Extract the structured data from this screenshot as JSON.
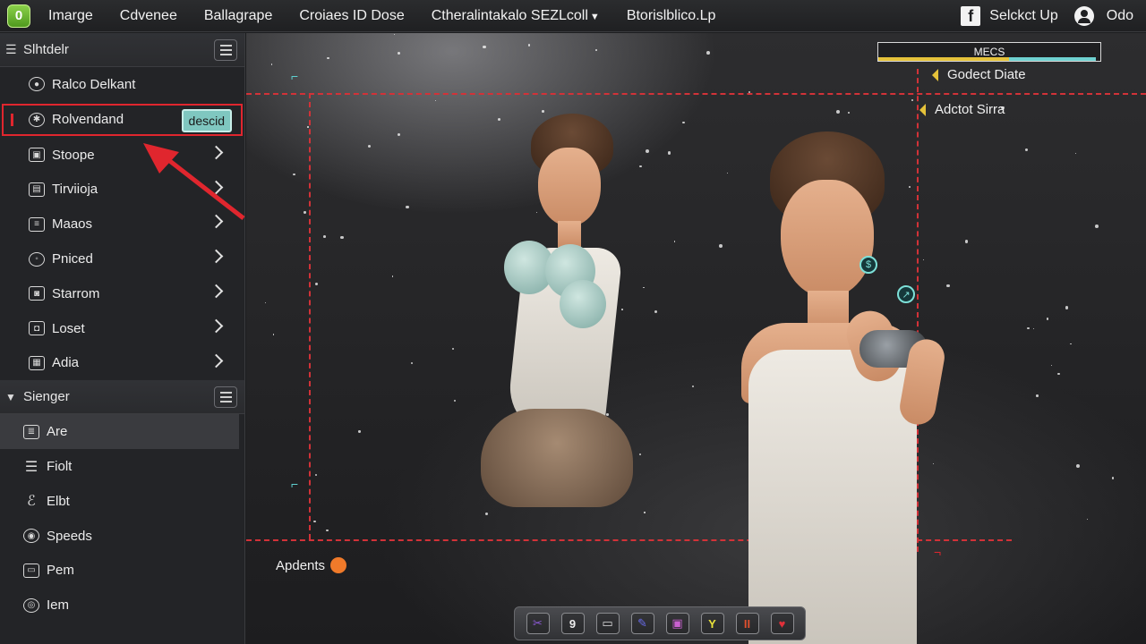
{
  "menu": {
    "items": [
      "Imarge",
      "Cdvenee",
      "Ballagrape",
      "Croiaes ID Dose",
      "Ctheralintakalo SEZLcoll",
      "Btorislblico.Lp"
    ],
    "dropdown_index": 4,
    "right": {
      "signin": "Selckct Up",
      "user": "Odo"
    }
  },
  "sidebar": {
    "section1": {
      "title": "Slhtdelr",
      "items": [
        {
          "label": "Ralco Delkant",
          "icon": "person-icon",
          "has_chevron": false
        },
        {
          "label": "Rolvendand",
          "icon": "gear-icon",
          "badge": "descid",
          "selected": true
        },
        {
          "label": "Stoope",
          "icon": "image-icon",
          "has_chevron": true
        },
        {
          "label": "Tirviioja",
          "icon": "image-icon",
          "has_chevron": true
        },
        {
          "label": "Maaos",
          "icon": "document-icon",
          "has_chevron": true
        },
        {
          "label": "Pniced",
          "icon": "pin-icon",
          "has_chevron": true
        },
        {
          "label": "Starrom",
          "icon": "camera-icon",
          "has_chevron": true
        },
        {
          "label": "Loset",
          "icon": "folder-icon",
          "has_chevron": true
        },
        {
          "label": "Adia",
          "icon": "stack-icon",
          "has_chevron": true
        }
      ]
    },
    "section2": {
      "title": "Sienger",
      "items": [
        {
          "label": "Are",
          "icon": "list-icon",
          "active": true
        },
        {
          "label": "Fiolt",
          "icon": "lines-icon"
        },
        {
          "label": "Elbt",
          "icon": "edit-icon"
        },
        {
          "label": "Speeds",
          "icon": "speed-icon"
        },
        {
          "label": "Pem",
          "icon": "pen-icon"
        },
        {
          "label": "Iem",
          "icon": "target-icon"
        }
      ]
    }
  },
  "canvas": {
    "stats_label": "MECS",
    "stats_fill": 0.98,
    "notes": [
      "Godect Diate",
      "Adctot Sirra"
    ],
    "appends_label": "Apdents",
    "marker_glyphs": [
      "$",
      "↗"
    ]
  },
  "dock": {
    "buttons": [
      {
        "name": "shuffle-icon",
        "glyph": "✂",
        "color": "#8e5ad9"
      },
      {
        "name": "nine-icon",
        "glyph": "9",
        "color": "#eeeeee"
      },
      {
        "name": "window-icon",
        "glyph": "▭",
        "color": "#dddddd"
      },
      {
        "name": "paint-icon",
        "glyph": "✎",
        "color": "#6a6ef0"
      },
      {
        "name": "palette-icon",
        "glyph": "▣",
        "color": "#c960d0"
      },
      {
        "name": "yellow-y-icon",
        "glyph": "Y",
        "color": "#e8e23a"
      },
      {
        "name": "orange-ii-icon",
        "glyph": "II",
        "color": "#e0502e"
      },
      {
        "name": "heart-icon",
        "glyph": "♥",
        "color": "#e0303a"
      }
    ]
  },
  "colors": {
    "accent_red": "#e0262e",
    "badge_teal": "#7fc7c0",
    "guide_red": "#d23238",
    "marker_teal": "#7de0d8"
  }
}
